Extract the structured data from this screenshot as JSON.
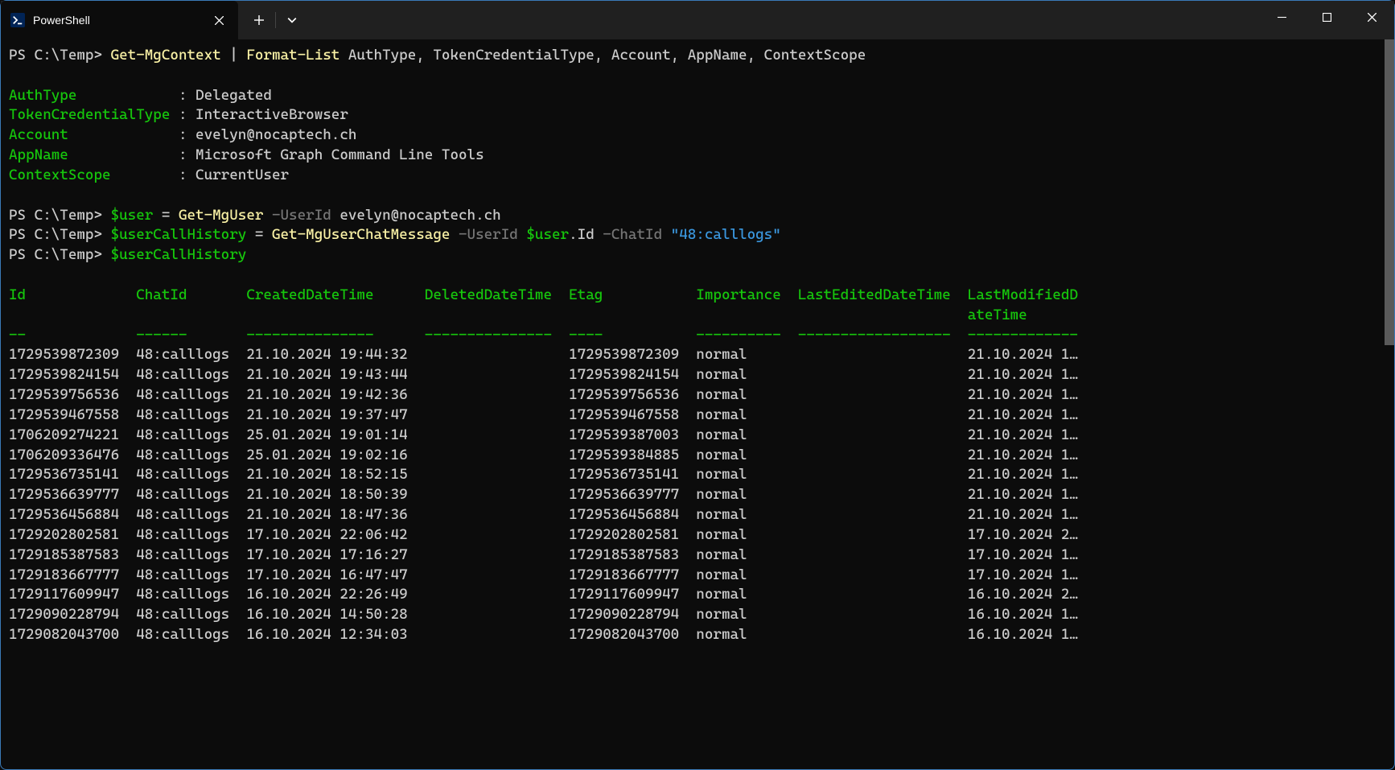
{
  "window": {
    "tab_title": "PowerShell"
  },
  "prompt": "PS C:\\Temp>",
  "commands": {
    "line1": {
      "cmd1": "Get-MgContext",
      "pipe": "|",
      "cmd2": "Format-List",
      "args": "AuthType, TokenCredentialType, Account, AppName, ContextScope"
    },
    "line2": {
      "var": "$user",
      "eq": " = ",
      "cmd": "Get-MgUser",
      "param": "-UserId",
      "val": "evelyn@nocaptech.ch"
    },
    "line3": {
      "var": "$userCallHistory",
      "eq": " = ",
      "cmd": "Get-MgUserChatMessage",
      "param1": "-UserId",
      "val1": "$user",
      "prop1": ".Id",
      "param2": "-ChatId",
      "val2": "\"48:calllogs\""
    },
    "line4": {
      "var": "$userCallHistory"
    }
  },
  "context": {
    "fields": [
      {
        "label": "AuthType",
        "value": "Delegated"
      },
      {
        "label": "TokenCredentialType",
        "value": "InteractiveBrowser"
      },
      {
        "label": "Account",
        "value": "evelyn@nocaptech.ch"
      },
      {
        "label": "AppName",
        "value": "Microsoft Graph Command Line Tools"
      },
      {
        "label": "ContextScope",
        "value": "CurrentUser"
      }
    ]
  },
  "table": {
    "headers": [
      "Id",
      "ChatId",
      "CreatedDateTime",
      "DeletedDateTime",
      "Etag",
      "Importance",
      "LastEditedDateTime",
      "LastModifiedDateTime"
    ],
    "rows": [
      {
        "Id": "1729539872309",
        "ChatId": "48:calllogs",
        "CreatedDateTime": "21.10.2024 19:44:32",
        "DeletedDateTime": "",
        "Etag": "1729539872309",
        "Importance": "normal",
        "LastEditedDateTime": "",
        "LastModifiedDateTime": "21.10.2024 1…"
      },
      {
        "Id": "1729539824154",
        "ChatId": "48:calllogs",
        "CreatedDateTime": "21.10.2024 19:43:44",
        "DeletedDateTime": "",
        "Etag": "1729539824154",
        "Importance": "normal",
        "LastEditedDateTime": "",
        "LastModifiedDateTime": "21.10.2024 1…"
      },
      {
        "Id": "1729539756536",
        "ChatId": "48:calllogs",
        "CreatedDateTime": "21.10.2024 19:42:36",
        "DeletedDateTime": "",
        "Etag": "1729539756536",
        "Importance": "normal",
        "LastEditedDateTime": "",
        "LastModifiedDateTime": "21.10.2024 1…"
      },
      {
        "Id": "1729539467558",
        "ChatId": "48:calllogs",
        "CreatedDateTime": "21.10.2024 19:37:47",
        "DeletedDateTime": "",
        "Etag": "1729539467558",
        "Importance": "normal",
        "LastEditedDateTime": "",
        "LastModifiedDateTime": "21.10.2024 1…"
      },
      {
        "Id": "1706209274221",
        "ChatId": "48:calllogs",
        "CreatedDateTime": "25.01.2024 19:01:14",
        "DeletedDateTime": "",
        "Etag": "1729539387003",
        "Importance": "normal",
        "LastEditedDateTime": "",
        "LastModifiedDateTime": "21.10.2024 1…"
      },
      {
        "Id": "1706209336476",
        "ChatId": "48:calllogs",
        "CreatedDateTime": "25.01.2024 19:02:16",
        "DeletedDateTime": "",
        "Etag": "1729539384885",
        "Importance": "normal",
        "LastEditedDateTime": "",
        "LastModifiedDateTime": "21.10.2024 1…"
      },
      {
        "Id": "1729536735141",
        "ChatId": "48:calllogs",
        "CreatedDateTime": "21.10.2024 18:52:15",
        "DeletedDateTime": "",
        "Etag": "1729536735141",
        "Importance": "normal",
        "LastEditedDateTime": "",
        "LastModifiedDateTime": "21.10.2024 1…"
      },
      {
        "Id": "1729536639777",
        "ChatId": "48:calllogs",
        "CreatedDateTime": "21.10.2024 18:50:39",
        "DeletedDateTime": "",
        "Etag": "1729536639777",
        "Importance": "normal",
        "LastEditedDateTime": "",
        "LastModifiedDateTime": "21.10.2024 1…"
      },
      {
        "Id": "1729536456884",
        "ChatId": "48:calllogs",
        "CreatedDateTime": "21.10.2024 18:47:36",
        "DeletedDateTime": "",
        "Etag": "1729536456884",
        "Importance": "normal",
        "LastEditedDateTime": "",
        "LastModifiedDateTime": "21.10.2024 1…"
      },
      {
        "Id": "1729202802581",
        "ChatId": "48:calllogs",
        "CreatedDateTime": "17.10.2024 22:06:42",
        "DeletedDateTime": "",
        "Etag": "1729202802581",
        "Importance": "normal",
        "LastEditedDateTime": "",
        "LastModifiedDateTime": "17.10.2024 2…"
      },
      {
        "Id": "1729185387583",
        "ChatId": "48:calllogs",
        "CreatedDateTime": "17.10.2024 17:16:27",
        "DeletedDateTime": "",
        "Etag": "1729185387583",
        "Importance": "normal",
        "LastEditedDateTime": "",
        "LastModifiedDateTime": "17.10.2024 1…"
      },
      {
        "Id": "1729183667777",
        "ChatId": "48:calllogs",
        "CreatedDateTime": "17.10.2024 16:47:47",
        "DeletedDateTime": "",
        "Etag": "1729183667777",
        "Importance": "normal",
        "LastEditedDateTime": "",
        "LastModifiedDateTime": "17.10.2024 1…"
      },
      {
        "Id": "1729117609947",
        "ChatId": "48:calllogs",
        "CreatedDateTime": "16.10.2024 22:26:49",
        "DeletedDateTime": "",
        "Etag": "1729117609947",
        "Importance": "normal",
        "LastEditedDateTime": "",
        "LastModifiedDateTime": "16.10.2024 2…"
      },
      {
        "Id": "1729090228794",
        "ChatId": "48:calllogs",
        "CreatedDateTime": "16.10.2024 14:50:28",
        "DeletedDateTime": "",
        "Etag": "1729090228794",
        "Importance": "normal",
        "LastEditedDateTime": "",
        "LastModifiedDateTime": "16.10.2024 1…"
      },
      {
        "Id": "1729082043700",
        "ChatId": "48:calllogs",
        "CreatedDateTime": "16.10.2024 12:34:03",
        "DeletedDateTime": "",
        "Etag": "1729082043700",
        "Importance": "normal",
        "LastEditedDateTime": "",
        "LastModifiedDateTime": "16.10.2024 1…"
      }
    ]
  },
  "col_widths": {
    "Id": 15,
    "ChatId": 13,
    "CreatedDateTime": 21,
    "DeletedDateTime": 16,
    "Etag": 15,
    "Importance": 11,
    "LastEditedDateTime": 19,
    "LastModifiedDateTime": 14
  }
}
